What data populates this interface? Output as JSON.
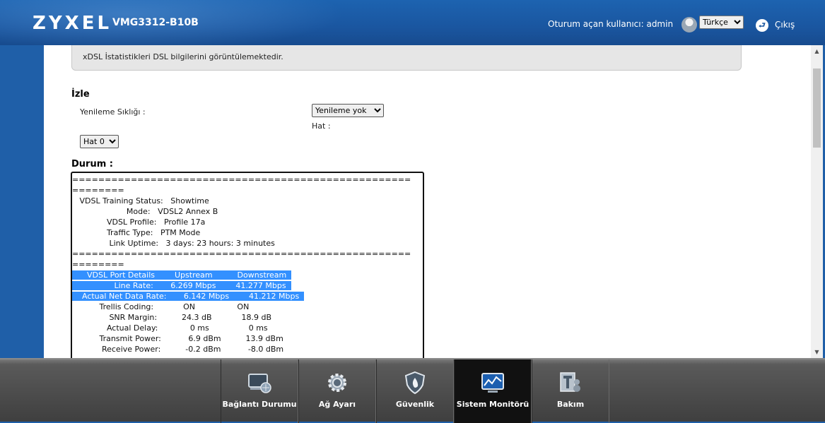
{
  "header": {
    "brand": "ZYXEL",
    "model": "VMG3312-B10B",
    "login_text": "Oturum açan kullanıcı: admin",
    "language": "Türkçe",
    "logout": "Çıkış"
  },
  "info": {
    "message": "xDSL İstatistikleri DSL bilgilerini görüntülemektedir."
  },
  "monitor": {
    "title": "İzle",
    "refresh_label": "Yenileme Sıklığı :",
    "refresh_value": "Yenileme yok",
    "line_label": "Hat :",
    "line_value": "Hat 0"
  },
  "status": {
    "title": "Durum :",
    "lines": [
      "====================================================",
      "========",
      "   VDSL Training Status:   Showtime",
      "                      Mode:   VDSL2 Annex B",
      "              VDSL Profile:   Profile 17a",
      "              Traffic Type:   PTM Mode",
      "               Link Uptime:   3 days: 23 hours: 3 minutes",
      "====================================================",
      "========"
    ],
    "highlight_lines": [
      "      VDSL Port Details        Upstream          Downstream  ",
      "                 Line Rate:       6.269 Mbps        41.277 Mbps  ",
      "    Actual Net Data Rate:       6.142 Mbps        41.212 Mbps  "
    ],
    "rest_lines": [
      "           Trellis Coding:            ON                 ON",
      "               SNR Margin:          24.3 dB            18.9 dB",
      "              Actual Delay:             0 ms                0 ms",
      "           Transmit Power:           6.9 dBm          13.9 dBm",
      "            Receive Power:          -0.2 dBm           -8.0 dBm"
    ]
  },
  "nav": {
    "items": [
      {
        "label": "Bağlantı Durumu",
        "icon": "connection-status-icon"
      },
      {
        "label": "Ağ Ayarı",
        "icon": "network-settings-icon"
      },
      {
        "label": "Güvenlik",
        "icon": "security-icon"
      },
      {
        "label": "Sistem Monitörü",
        "icon": "system-monitor-icon"
      },
      {
        "label": "Bakım",
        "icon": "maintenance-icon"
      }
    ],
    "active_index": 3
  },
  "colors": {
    "header_blue": "#1a56a0",
    "selection_blue": "#3390ff",
    "nav_active": "#111111"
  }
}
